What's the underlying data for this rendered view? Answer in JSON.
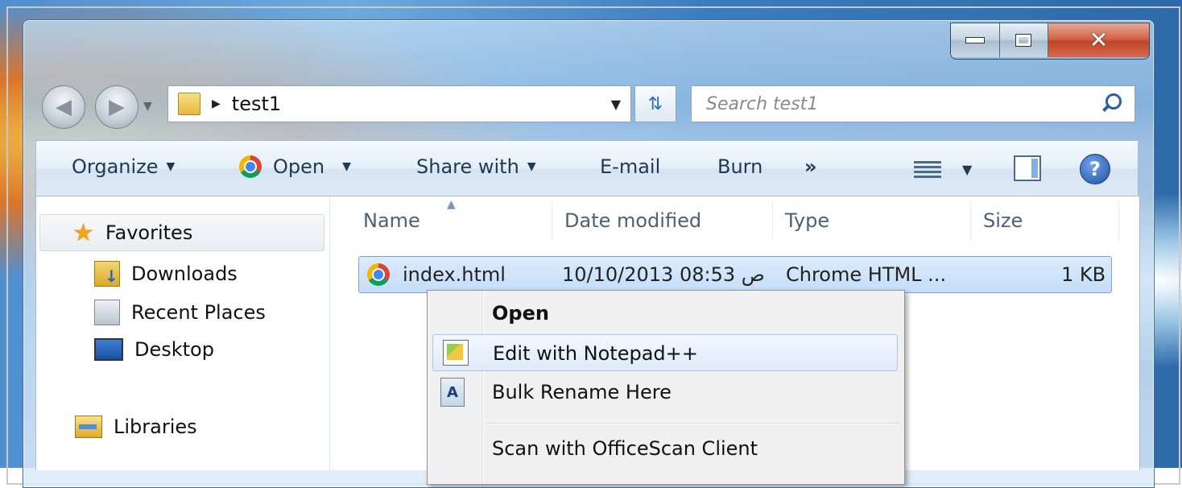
{
  "address": {
    "path": "test1"
  },
  "search": {
    "placeholder": "Search test1"
  },
  "toolbar": {
    "organize": "Organize",
    "open": "Open",
    "share_with": "Share with",
    "email": "E-mail",
    "burn": "Burn",
    "more": "»"
  },
  "help_label": "?",
  "nav": {
    "favorites": "Favorites",
    "items": [
      {
        "label": "Downloads",
        "icon": "downloads-folder-icon"
      },
      {
        "label": "Recent Places",
        "icon": "recent-places-icon"
      },
      {
        "label": "Desktop",
        "icon": "desktop-icon"
      }
    ],
    "libraries": "Libraries"
  },
  "columns": [
    "Name",
    "Date modified",
    "Type",
    "Size"
  ],
  "files": [
    {
      "name": "index.html",
      "date": "10/10/2013 08:53 ص",
      "type": "Chrome HTML ...",
      "size": "1 KB",
      "icon": "chrome-html-icon"
    }
  ],
  "context_menu": {
    "open": "Open",
    "edit_notepad": "Edit with Notepad++",
    "bulk_rename": "Bulk Rename Here",
    "scan": "Scan with OfficeScan Client"
  },
  "colors": {
    "selection": "#c4ddf8",
    "toolbar_text": "#1e3956",
    "close_button": "#c0442a"
  }
}
